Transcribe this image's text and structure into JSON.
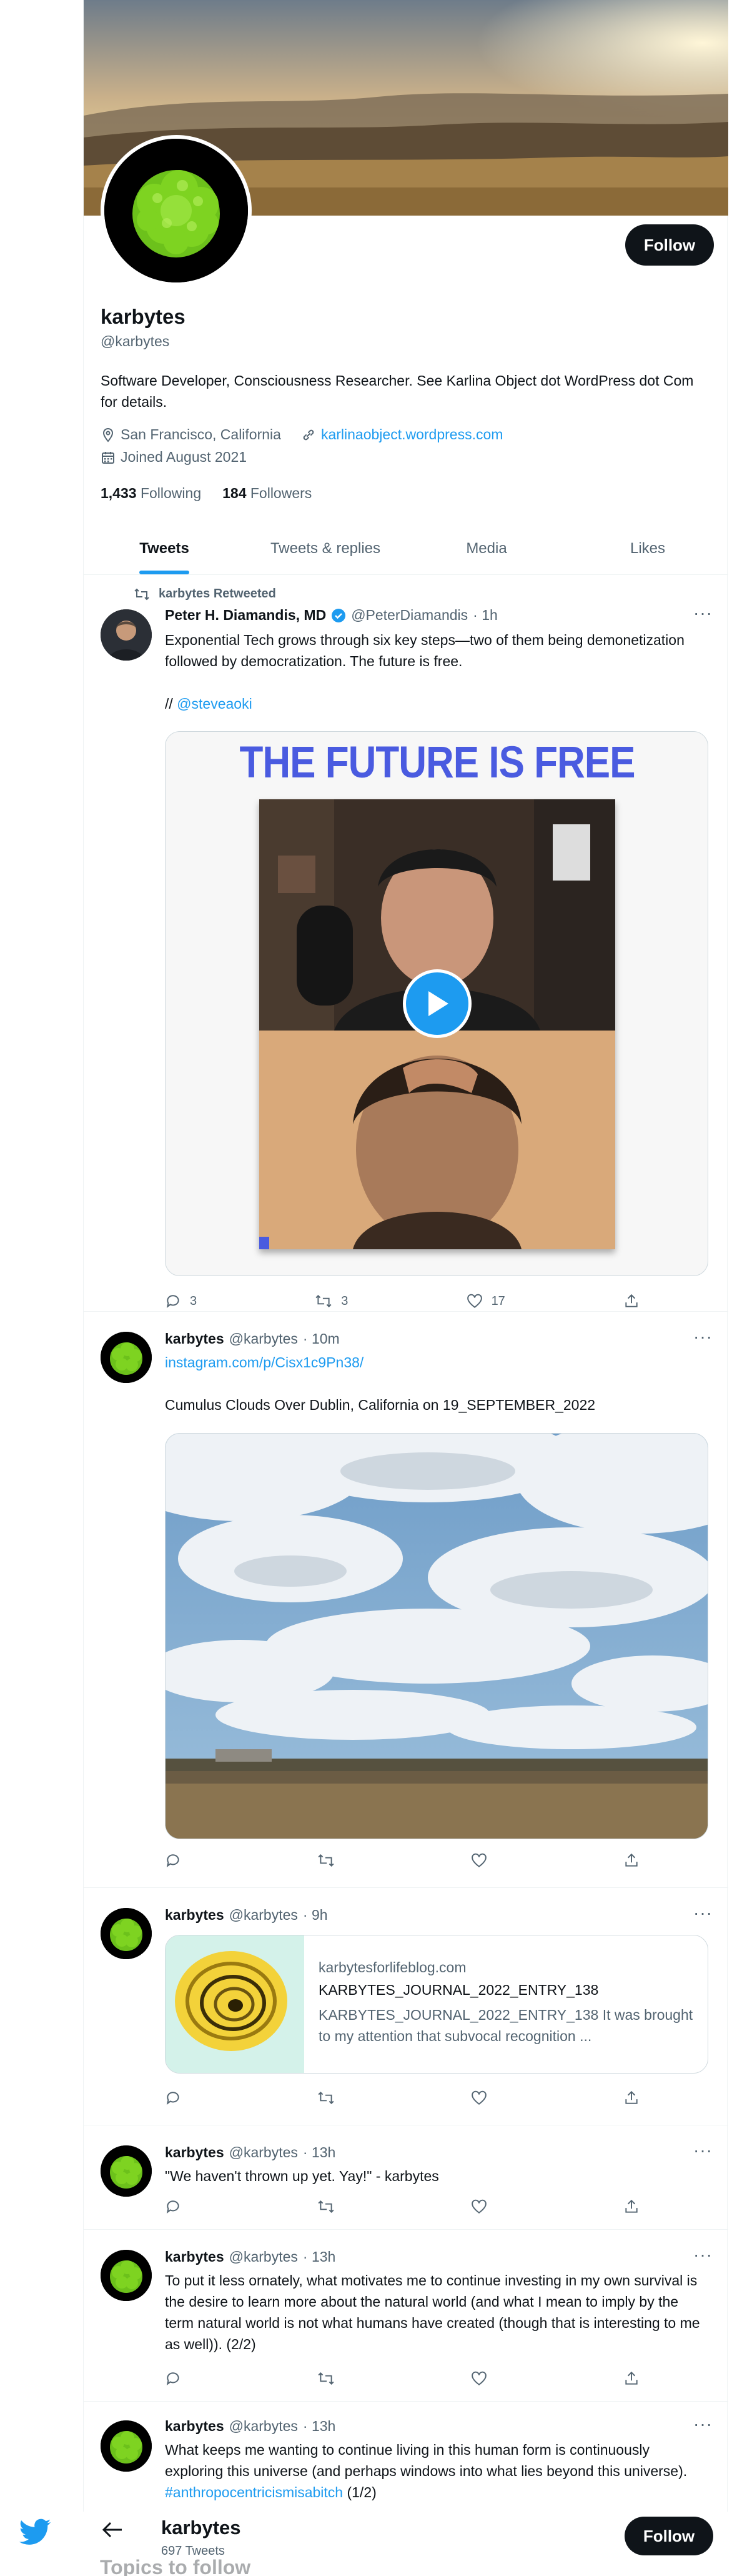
{
  "profile": {
    "name": "karbytes",
    "handle": "@karbytes",
    "bio": "Software Developer, Consciousness Researcher. See Karlina Object dot WordPress dot Com for details.",
    "location": "San Francisco, California",
    "website": "karlinaobject.wordpress.com",
    "joined": "Joined August 2021",
    "following_count": "1,433",
    "following_label": "Following",
    "followers_count": "184",
    "followers_label": "Followers",
    "follow_label": "Follow"
  },
  "tabs": [
    {
      "label": "Tweets",
      "active": true
    },
    {
      "label": "Tweets & replies"
    },
    {
      "label": "Media"
    },
    {
      "label": "Likes"
    }
  ],
  "tweets": [
    {
      "retweet_label": "karbytes Retweeted",
      "name": "Peter H. Diamandis, MD",
      "handle": "@PeterDiamandis",
      "time": "· 1h",
      "text1": "Exponential Tech grows through six key steps—two of them being demonetization followed by democratization. The future is free.",
      "text2_prefix": "//",
      "mention": "@steveaoki",
      "video_title": "THE FUTURE IS FREE",
      "replies": "3",
      "retweets": "3",
      "likes": "17"
    },
    {
      "name": "karbytes",
      "handle": "@karbytes",
      "time": "· 10m",
      "link": "instagram.com/p/Cisx1c9Pn38/",
      "text": "Cumulus Clouds Over Dublin, California on 19_SEPTEMBER_2022"
    },
    {
      "name": "karbytes",
      "handle": "@karbytes",
      "time": "· 9h",
      "card_domain": "karbytesforlifeblog.com",
      "card_title": "KARBYTES_JOURNAL_2022_ENTRY_138",
      "card_desc": "KARBYTES_JOURNAL_2022_ENTRY_138 It was brought to my attention that subvocal recognition ..."
    },
    {
      "name": "karbytes",
      "handle": "@karbytes",
      "time": "· 13h",
      "text": "\"We haven't thrown up yet. Yay!\" - karbytes"
    },
    {
      "name": "karbytes",
      "handle": "@karbytes",
      "time": "· 13h",
      "text": "To put it less ornately, what motivates me to continue investing in my own survival is the desire to learn more about the natural world (and what I mean to imply by the term natural world is not what humans have created (though that is interesting to me as well)). (2/2)"
    },
    {
      "name": "karbytes",
      "handle": "@karbytes",
      "time": "· 13h",
      "text_main": "What keeps me wanting to continue living in this human form is continuously exploring this universe (and perhaps windows into what lies beyond this universe).",
      "hashtag": "#anthropocentricismisabitch",
      "text_tail": "(1/2)"
    }
  ],
  "bottom_bar": {
    "name": "karbytes",
    "tweet_count": "697 Tweets",
    "follow_label": "Follow",
    "peek_text": "Topics to follow"
  },
  "colors": {
    "accent": "#1d9bf0",
    "text": "#0f1419",
    "muted": "#536471",
    "border": "#eff3f4"
  }
}
